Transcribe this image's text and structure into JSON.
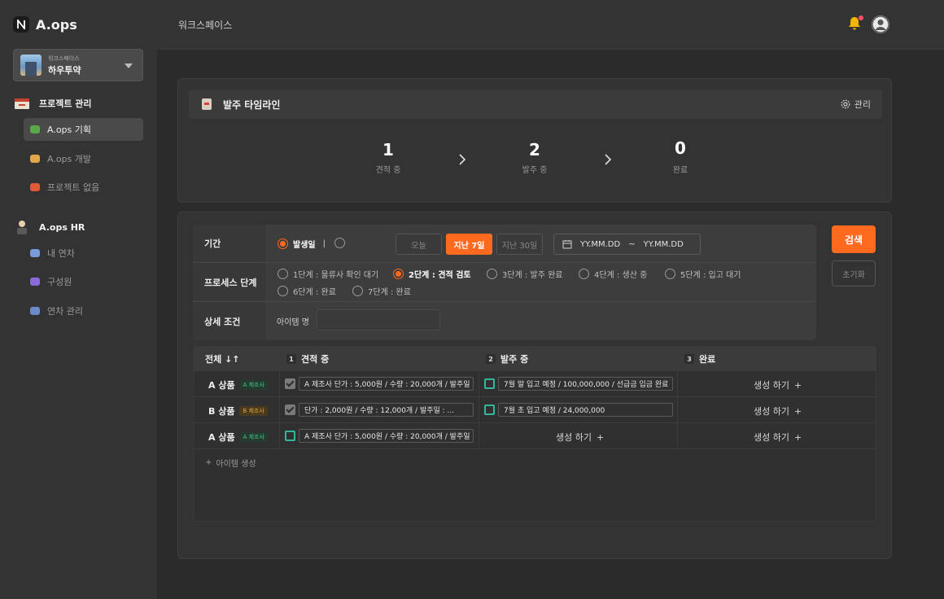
{
  "brand": {
    "name": "A.ops"
  },
  "workspace": {
    "small_label": "워크스페이스",
    "name": "하우투약"
  },
  "sidebar": {
    "groups": [
      {
        "label": "프로젝트 관리",
        "icon": "calendar-icon",
        "items": [
          {
            "label": "A.ops 기획",
            "icon": "frog-icon",
            "active": true
          },
          {
            "label": "A.ops 개발",
            "icon": "hamburger-icon",
            "active": false
          },
          {
            "label": "프로젝트 없음",
            "icon": "popcorn-icon",
            "active": false
          }
        ]
      },
      {
        "label": "A.ops HR",
        "icon": "person-icon",
        "items": [
          {
            "label": "내 연차",
            "icon": "calendar-icon",
            "active": false
          },
          {
            "label": "구성원",
            "icon": "people-icon",
            "active": false
          },
          {
            "label": "연차 관리",
            "icon": "jacket-icon",
            "active": false
          }
        ]
      }
    ]
  },
  "header": {
    "title": "워크스페이스"
  },
  "timeline": {
    "title": "발주 타임라인",
    "manage_label": "관리",
    "stages": [
      {
        "count": "1",
        "label": "견적 중"
      },
      {
        "count": "2",
        "label": "발주 중"
      },
      {
        "count": "0",
        "label": "완료"
      }
    ]
  },
  "filter": {
    "period_label": "기간",
    "date_type_selected": "발생일",
    "period_buttons": [
      "오늘",
      "지난 7일",
      "지난 30일"
    ],
    "period_active": "지난 7일",
    "date_from": "YY.MM.DD",
    "date_sep": "~",
    "date_to": "YY.MM.DD",
    "process_label": "프로세스 단계",
    "process_options": [
      {
        "num": "1단계",
        "text": " : 물류사 확인 대기"
      },
      {
        "num": "2단계",
        "text": " : 견적 검토"
      },
      {
        "num": "3단계",
        "text": " : 발주 완료"
      },
      {
        "num": "4단계",
        "text": " : 생산 중"
      },
      {
        "num": "5단계",
        "text": " : 입고 대기"
      },
      {
        "num": "6단계",
        "text": " : 완료"
      },
      {
        "num": "7단계",
        "text": " : 완료"
      }
    ],
    "process_selected": "2단계",
    "detail_label": "상세 조건",
    "item_name_label": "아이템 명",
    "item_name_value": "",
    "search_label": "검색",
    "reset_label": "초기화"
  },
  "table": {
    "col_all": "전체 ↓↑",
    "col_headers": [
      {
        "num": "1",
        "label": "견적 중"
      },
      {
        "num": "2",
        "label": "발주 중"
      },
      {
        "num": "3",
        "label": "완료"
      }
    ],
    "rows": [
      {
        "product": "A 상품",
        "vendor": "A 제조사",
        "vendor_color": "a",
        "c1_checked": "gray",
        "c1": "A 제조사 단가 : 5,000원 / 수량 : 20,000개 / 발주일 : ...",
        "c2_checked": "green",
        "c2": "7월 말 입고 예정 / 100,000,000 / 선급금 입금 완료",
        "c3": "생성 하기"
      },
      {
        "product": "B 상품",
        "vendor": "B 제조사",
        "vendor_color": "b",
        "c1_checked": "gray",
        "c1": "단가 : 2,000원 / 수량 : 12,000개 / 발주일 : ...",
        "c2_checked": "green",
        "c2": "7월 초 입고 예정 / 24,000,000",
        "c3": "생성 하기"
      },
      {
        "product": "A 상품",
        "vendor": "A 제조사",
        "vendor_color": "a",
        "c1_checked": "green",
        "c1": "A 제조사 단가 : 5,000원 / 수량 : 20,000개 / 발주일 : ...",
        "c2": "생성 하기",
        "c3": "생성 하기"
      }
    ],
    "add_item_label": "아이템 생성"
  },
  "colors": {
    "accent": "#ff6a1e",
    "check_green": "#2fb89a",
    "bell": "#f5b400",
    "bell_dot": "#ff4d6a"
  }
}
